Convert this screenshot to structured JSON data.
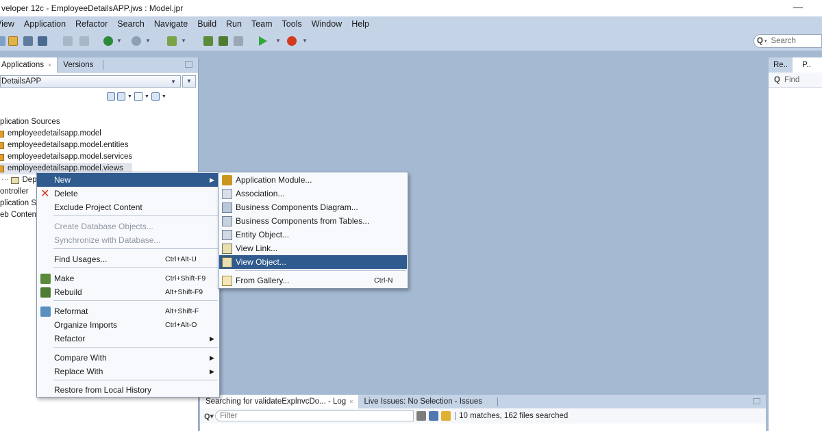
{
  "window": {
    "title": "veloper 12c - EmployeeDetailsAPP.jws : Model.jpr",
    "minimize": "—"
  },
  "menubar": [
    "View",
    "Application",
    "Refactor",
    "Search",
    "Navigate",
    "Build",
    "Run",
    "Team",
    "Tools",
    "Window",
    "Help"
  ],
  "toolbar": {
    "search_placeholder": "Search"
  },
  "left_panel": {
    "tabs": [
      {
        "label": "Applications",
        "close": "×"
      },
      {
        "label": "Versions"
      }
    ],
    "app_selector": "DetailsAPP",
    "tree": [
      "plication Sources",
      "employeedetailsapp.model",
      "employeedetailsapp.model.entities",
      "employeedetailsapp.model.services",
      "employeedetailsapp.model.views",
      "Depa",
      "ontroller",
      "plication So",
      "eb Content"
    ]
  },
  "context_menu": {
    "items": [
      {
        "label": "New",
        "arrow": "▶"
      },
      {
        "label": "Delete"
      },
      {
        "label": "Exclude Project Content"
      },
      {
        "label": "Create Database Objects..."
      },
      {
        "label": "Synchronize with Database..."
      },
      {
        "label": "Find Usages...",
        "shortcut": "Ctrl+Alt-U"
      },
      {
        "label": "Make",
        "shortcut": "Ctrl+Shift-F9"
      },
      {
        "label": "Rebuild",
        "shortcut": "Alt+Shift-F9"
      },
      {
        "label": "Reformat",
        "shortcut": "Alt+Shift-F"
      },
      {
        "label": "Organize Imports",
        "shortcut": "Ctrl+Alt-O"
      },
      {
        "label": "Refactor",
        "arrow": "▶"
      },
      {
        "label": "Compare With",
        "arrow": "▶"
      },
      {
        "label": "Replace With",
        "arrow": "▶"
      },
      {
        "label": "Restore from Local History"
      }
    ]
  },
  "submenu": {
    "items": [
      {
        "label": "Application Module..."
      },
      {
        "label": "Association..."
      },
      {
        "label": "Business Components Diagram..."
      },
      {
        "label": "Business Components from Tables..."
      },
      {
        "label": "Entity Object..."
      },
      {
        "label": "View Link..."
      },
      {
        "label": "View Object..."
      },
      {
        "label": "From Gallery...",
        "shortcut": "Ctrl-N"
      }
    ]
  },
  "right_panel": {
    "tabs": [
      "Re..",
      "P.."
    ],
    "close": "×",
    "find_placeholder": "Find"
  },
  "bottom_panel": {
    "tabs": [
      {
        "label": "Searching for validateExplnvcDo... - Log",
        "close": "×"
      },
      {
        "label": "Live Issues: No Selection - Issues"
      }
    ],
    "filter_placeholder": "Filter",
    "status": "10 matches, 162 files searched"
  },
  "colors": {
    "workspace": "#a4b9d2",
    "chrome": "#c5d3e6",
    "highlight": "#2f5b8e"
  }
}
